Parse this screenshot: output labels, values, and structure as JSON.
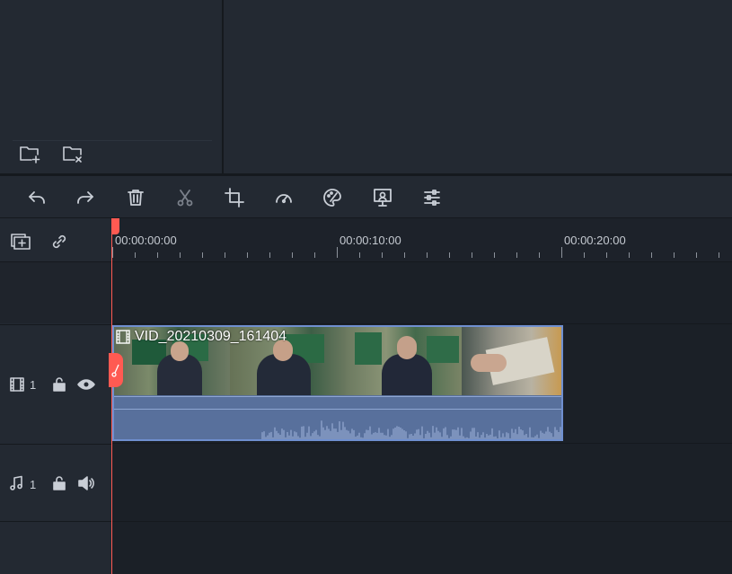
{
  "media_panel": {
    "buttons": [
      {
        "id": "new-folder",
        "icon": "folder-add-icon"
      },
      {
        "id": "delete-folder",
        "icon": "folder-remove-icon"
      }
    ]
  },
  "toolbar": {
    "buttons": [
      {
        "id": "undo",
        "icon": "undo-icon"
      },
      {
        "id": "redo",
        "icon": "redo-icon"
      },
      {
        "id": "delete",
        "icon": "trash-icon"
      },
      {
        "id": "cut",
        "icon": "scissors-icon"
      },
      {
        "id": "crop",
        "icon": "crop-icon"
      },
      {
        "id": "speed",
        "icon": "speedometer-icon"
      },
      {
        "id": "color",
        "icon": "palette-icon"
      },
      {
        "id": "green-screen",
        "icon": "green-screen-icon"
      },
      {
        "id": "adjust",
        "icon": "sliders-icon"
      }
    ]
  },
  "timeline": {
    "ruler_labels": [
      "00:00:00:00",
      "00:00:10:00",
      "00:00:20:00"
    ],
    "tracks": {
      "video": {
        "number": "1"
      },
      "audio": {
        "number": "1"
      }
    },
    "clip": {
      "name": "VID_20210309_161404"
    }
  },
  "colors": {
    "playhead": "#ff5a52",
    "clip_border": "#6f8fd0",
    "clip_fill": "#58709c"
  }
}
